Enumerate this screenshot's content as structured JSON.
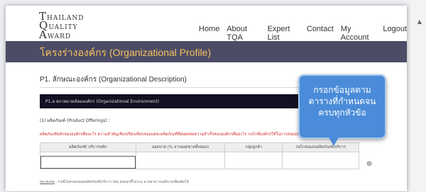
{
  "logo": {
    "line1": "HAILAND",
    "line1_initial": "T",
    "line2": "UALITY",
    "line2_initial": "Q",
    "line3": "WARD",
    "line3_initial": "A"
  },
  "nav": [
    "Home",
    "About TQA",
    "Expert List",
    "Contact",
    "My Account",
    "Logout"
  ],
  "banner": {
    "title": "โครงร่างองค์กร (Organizational Profile)"
  },
  "section": {
    "title": "P1. ลักษณะองค์กร (Organizational Description)"
  },
  "subbar": {
    "label": "P1.a สภาพแวดล้อมองค์กร (Organizational Environment)"
  },
  "question": {
    "label": "(1) ผลิตภัณฑ์ (Product Offerings) :"
  },
  "note": {
    "text": "ผลิตภัณฑ์หลักขององค์กรคืออะไร ความสำคัญเชิงเปรียบเทียบของแต่ละผลิตภัณฑ์ที่ส่งผลต่อความสำเร็จขององค์กรคืออะไร กลไกที่องค์กรใช้ในการส่งมอบผลิตภัณฑ์คืออะไร"
  },
  "table": {
    "headers": [
      "ผลิตภัณฑ์/ บริการหลัก",
      "ยอดขาย (% จากยอดขายทั้งหมด)",
      "กลุ่มลูกค้า",
      "กลไกส่งมอบผลิตภัณฑ์/บริการ"
    ],
    "row": [
      "",
      "",
      "",
      ""
    ]
  },
  "remark": {
    "label": "หมายเหตุ",
    "text": ": กรณีไม่ครอบคลุมผลิตภัณฑ์/บริการ เช่น ส่งออกที่ไม่ระบุ อาจสามารถอธิบายเพิ่มเติมได้"
  },
  "callout": {
    "lines": [
      "กรอกข้อมูลตาม",
      "ตารางที่กำหนดจน",
      "ครบทุกหัวข้อ"
    ]
  },
  "colors": {
    "banner": "#4d4c67",
    "banner_text": "#f4c15d",
    "note": "#d42828",
    "callout": "#4a8cd9"
  }
}
